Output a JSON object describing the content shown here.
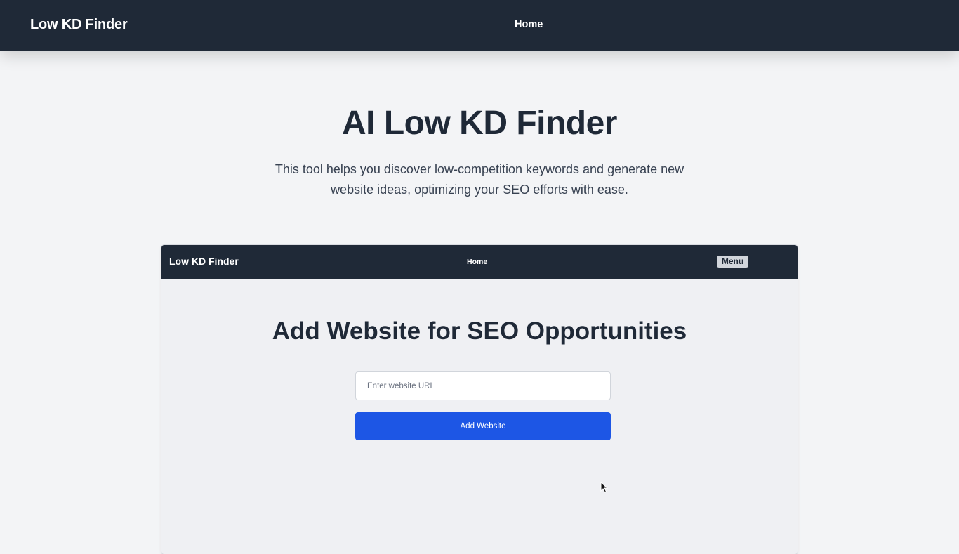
{
  "header": {
    "brand": "Low KD Finder",
    "nav": {
      "home": "Home"
    }
  },
  "hero": {
    "title": "AI Low KD Finder",
    "subtitle": "This tool helps you discover low-competition keywords and generate new website ideas, optimizing your SEO efforts with ease."
  },
  "preview": {
    "navbar": {
      "brand": "Low KD Finder",
      "home": "Home",
      "menu": "Menu"
    },
    "title": "Add Website for SEO Opportunities",
    "url_input": {
      "placeholder": "Enter website URL",
      "value": ""
    },
    "add_button": "Add Website"
  },
  "colors": {
    "navbar_bg": "#1f2937",
    "page_bg": "#f3f4f6",
    "primary_button": "#1d56e5"
  }
}
